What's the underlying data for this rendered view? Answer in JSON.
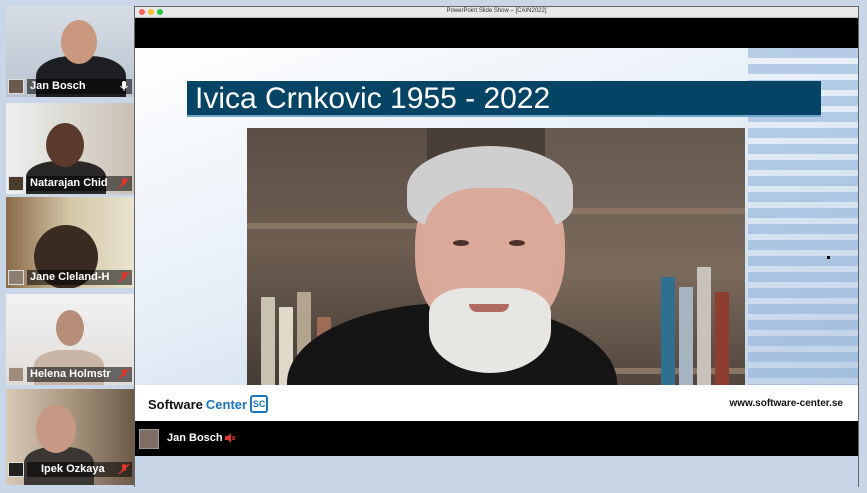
{
  "window": {
    "title": "PowerPoint Slide Show – [CAIN2022]"
  },
  "participants": [
    {
      "name": "Jan Bosch",
      "mic": "on"
    },
    {
      "name": "Natarajan Chid",
      "mic": "muted"
    },
    {
      "name": "Jane Cleland-H",
      "mic": "muted"
    },
    {
      "name": "Helena Holmstr",
      "mic": "muted"
    },
    {
      "name": "Ipek Ozkaya",
      "mic": "muted"
    }
  ],
  "slide": {
    "title": "Ivica Crnkovic 1955 - 2022",
    "brand_main": "Software ",
    "brand_accent": "Center",
    "brand_logo": "SC",
    "website": "www.software-center.se"
  },
  "active_speaker": {
    "name": "Jan Bosch",
    "mic": "muted"
  },
  "colors": {
    "title_bar": "#064466",
    "mute_red": "#e0342c",
    "brand_blue": "#1b75bb"
  },
  "icons": {
    "mic_on": "microphone-icon",
    "mic_muted": "microphone-muted-icon"
  }
}
